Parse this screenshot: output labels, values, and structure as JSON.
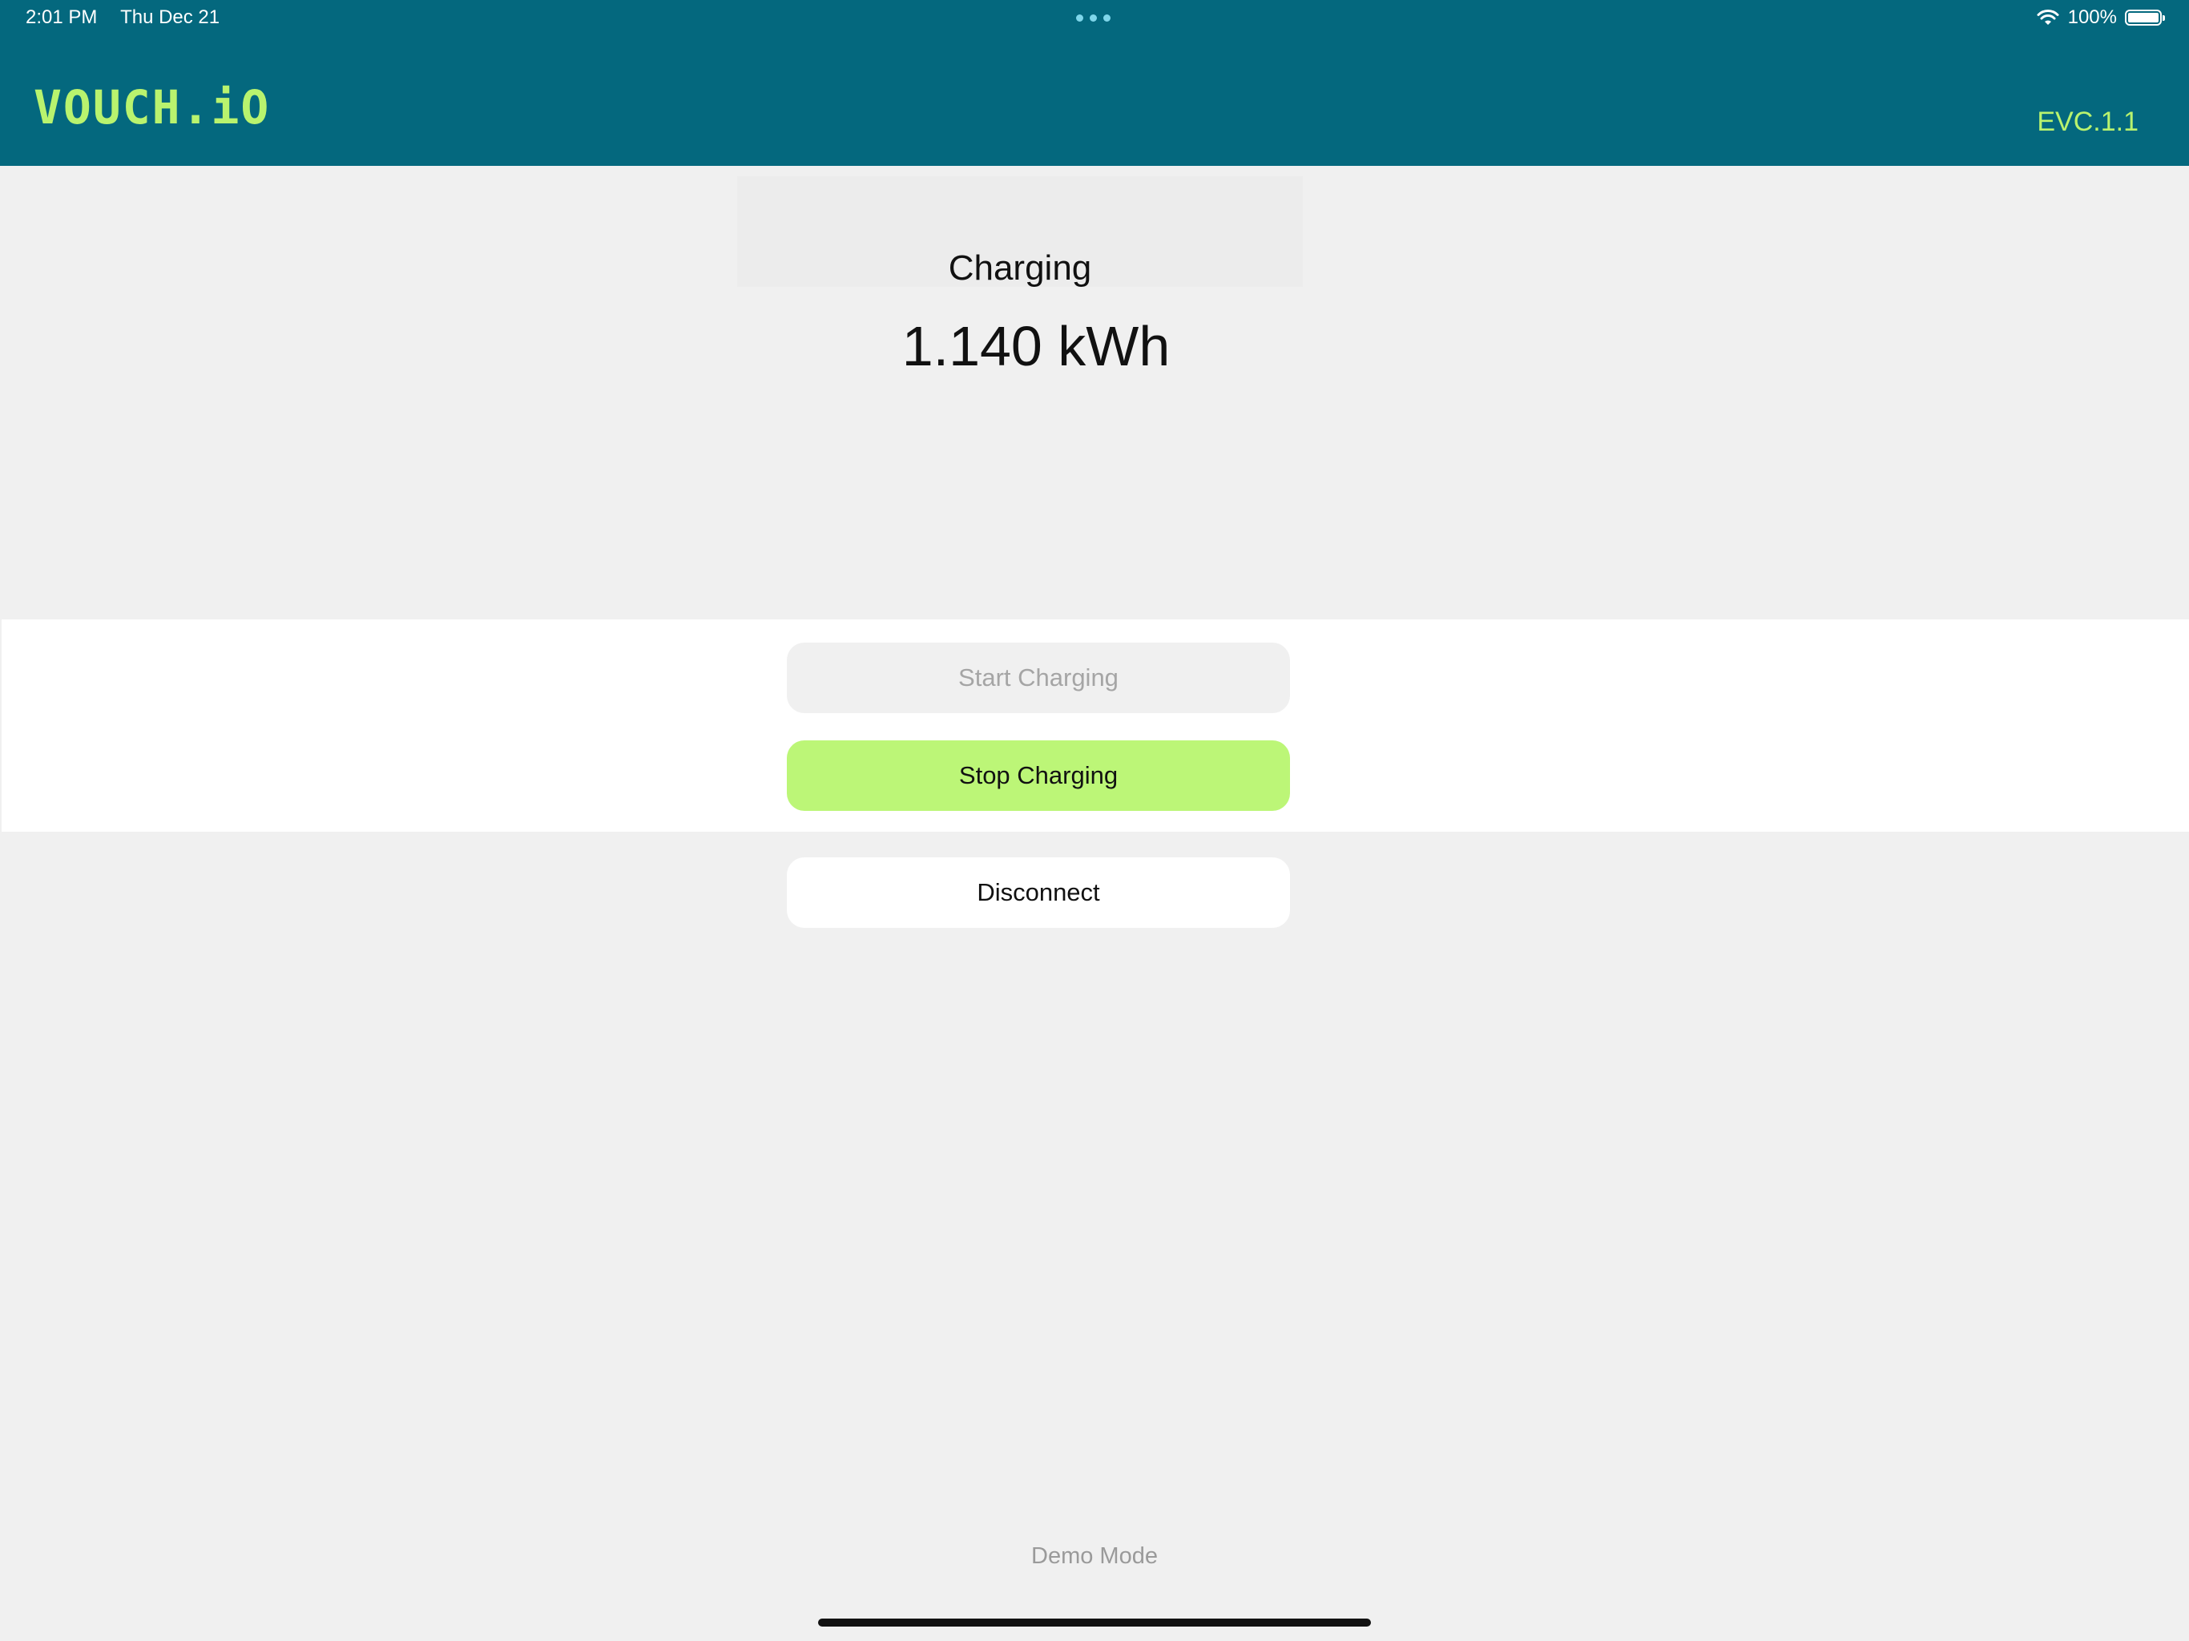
{
  "status_bar": {
    "time": "2:01 PM",
    "date": "Thu Dec 21",
    "battery_text": "100%",
    "battery_level": 1.0,
    "wifi_icon": "wifi-icon",
    "multitask_icon": "ellipsis-icon"
  },
  "header": {
    "logo_text": "VOUCH.iO",
    "version": "EVC.1.1",
    "background_color": "#04687e",
    "accent_color": "#b9f36e"
  },
  "charging": {
    "status": "Charging",
    "energy": "1.140 kWh"
  },
  "buttons": {
    "start_label": "Start Charging",
    "start_enabled": false,
    "stop_label": "Stop Charging",
    "stop_color": "#bcf677",
    "disconnect_label": "Disconnect"
  },
  "footer": {
    "mode_text": "Demo Mode"
  }
}
